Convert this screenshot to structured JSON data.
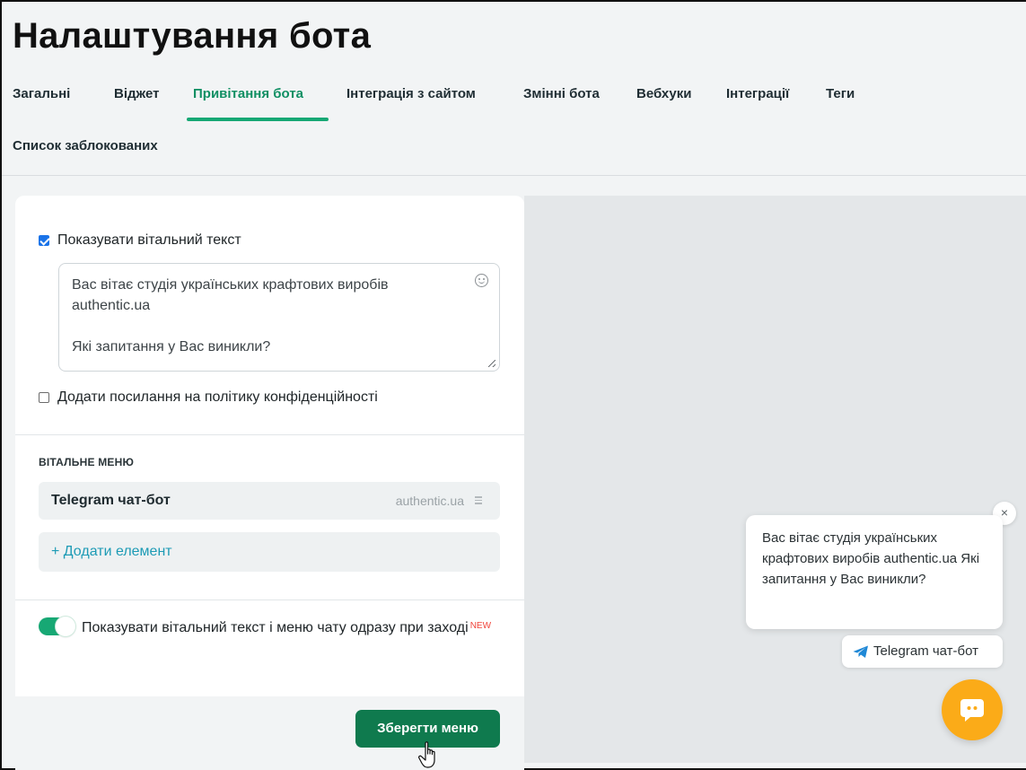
{
  "page": {
    "title": "Налаштування бота"
  },
  "tabs": [
    {
      "label": "Загальні"
    },
    {
      "label": "Віджет"
    },
    {
      "label": "Привітання бота",
      "active": true
    },
    {
      "label": "Інтеграція з сайтом"
    },
    {
      "label": "Змінні бота"
    },
    {
      "label": "Вебхуки"
    },
    {
      "label": "Інтеграції"
    },
    {
      "label": "Теги"
    },
    {
      "label": "Список заблокованих"
    }
  ],
  "welcome": {
    "show_text_label": "Показувати вітальний текст",
    "show_text_checked": true,
    "text_lines": [
      "Вас вітає студія українських крафтових виробів",
      "authentic.ua",
      "",
      "Які запитання у Вас виникли?"
    ],
    "privacy_label": "Додати посилання на політику конфіденційності",
    "privacy_checked": false
  },
  "menu": {
    "section_title": "ВІТАЛЬНЕ МЕНЮ",
    "items": [
      {
        "title": "Telegram чат-бот",
        "domain": "authentic.ua"
      }
    ],
    "add_label": "+ Додати елемент"
  },
  "toggle": {
    "label": "Показувати вітальний текст і меню чату одразу при заході",
    "badge": "NEW",
    "on": true
  },
  "save_label": "Зберегти меню",
  "preview": {
    "bubble_text": "Вас вітає студія українських крафтових виробів authentic.ua Які запитання у Вас виникли?",
    "close_symbol": "×",
    "chip_label": "Telegram чат-бот"
  },
  "colors": {
    "accent": "#17a874",
    "save_button": "#0f7a4e",
    "link": "#1d9bb5",
    "badge": "#f0433a",
    "chat_button": "#fbab18"
  }
}
